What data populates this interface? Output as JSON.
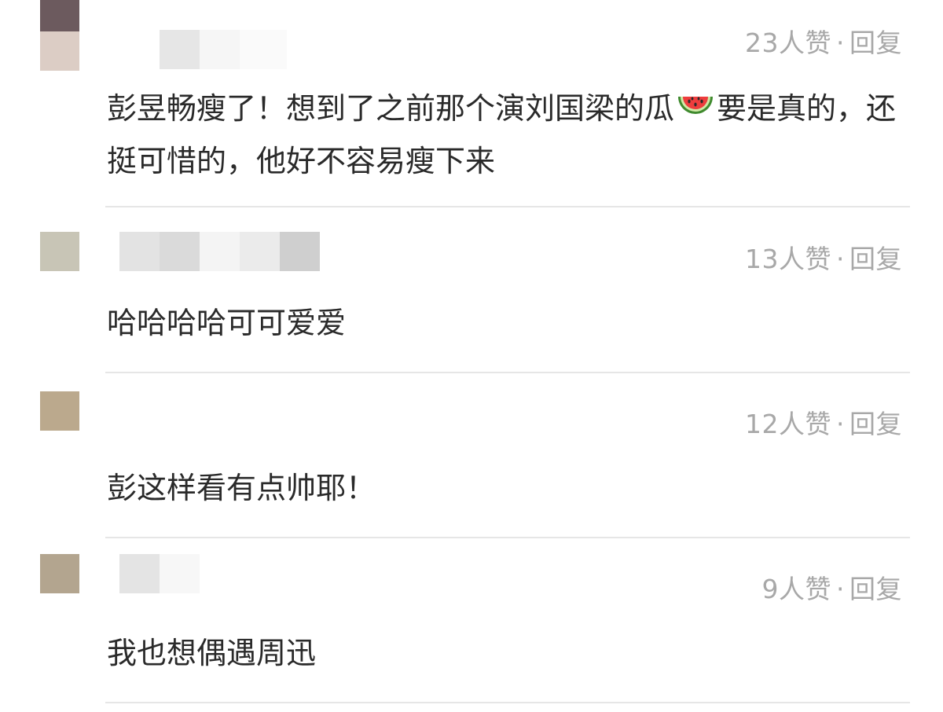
{
  "comments": [
    {
      "likes": "23人赞",
      "reply_label": "回复",
      "text_before_icon": "彭昱畅瘦了！想到了之前那个演刘国梁的瓜",
      "icon": "watermelon-icon",
      "text_after_icon": "要是真的，还挺可惜的，他好不容易瘦下来"
    },
    {
      "likes": "13人赞",
      "reply_label": "回复",
      "text": "哈哈哈哈可可爱爱"
    },
    {
      "likes": "12人赞",
      "reply_label": "回复",
      "text": "彭这样看有点帅耶！"
    },
    {
      "likes": "9人赞",
      "reply_label": "回复",
      "text": "我也想偶遇周迅"
    }
  ],
  "separator": "·",
  "colors": {
    "text": "#2a2a2a",
    "meta": "#a8a8a8",
    "divider": "#e6e6e6"
  }
}
